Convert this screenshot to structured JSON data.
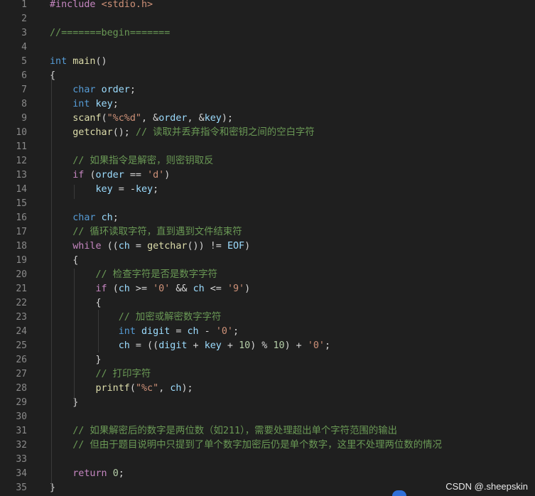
{
  "editor": {
    "theme": {
      "background": "#1f1f1f",
      "line_number": "#8a8a8a",
      "comment": "#6a9955"
    },
    "lines": [
      {
        "n": "1",
        "tokens": [
          [
            "pre",
            "#include "
          ],
          [
            "inc",
            "<stdio.h>"
          ]
        ]
      },
      {
        "n": "2",
        "tokens": []
      },
      {
        "n": "3",
        "tokens": [
          [
            "cm",
            "//=======begin======="
          ]
        ]
      },
      {
        "n": "4",
        "tokens": []
      },
      {
        "n": "5",
        "tokens": [
          [
            "kw",
            "int "
          ],
          [
            "fn",
            "main"
          ],
          [
            "op",
            "()"
          ]
        ]
      },
      {
        "n": "6",
        "tokens": [
          [
            "op",
            "{"
          ]
        ]
      },
      {
        "n": "7",
        "tokens": [
          [
            "op",
            "    "
          ],
          [
            "kw",
            "char "
          ],
          [
            "var",
            "order"
          ],
          [
            "op",
            ";"
          ]
        ]
      },
      {
        "n": "8",
        "tokens": [
          [
            "op",
            "    "
          ],
          [
            "kw",
            "int "
          ],
          [
            "var",
            "key"
          ],
          [
            "op",
            ";"
          ]
        ]
      },
      {
        "n": "9",
        "tokens": [
          [
            "op",
            "    "
          ],
          [
            "fn",
            "scanf"
          ],
          [
            "op",
            "("
          ],
          [
            "str",
            "\"%c%d\""
          ],
          [
            "op",
            ", &"
          ],
          [
            "var",
            "order"
          ],
          [
            "op",
            ", &"
          ],
          [
            "var",
            "key"
          ],
          [
            "op",
            ");"
          ]
        ]
      },
      {
        "n": "10",
        "tokens": [
          [
            "op",
            "    "
          ],
          [
            "fn",
            "getchar"
          ],
          [
            "op",
            "(); "
          ],
          [
            "cm",
            "// 读取并丢弃指令和密钥之间的空白字符"
          ]
        ]
      },
      {
        "n": "11",
        "tokens": []
      },
      {
        "n": "12",
        "tokens": [
          [
            "op",
            "    "
          ],
          [
            "cm",
            "// 如果指令是解密，则密钥取反"
          ]
        ]
      },
      {
        "n": "13",
        "tokens": [
          [
            "op",
            "    "
          ],
          [
            "ctrl",
            "if "
          ],
          [
            "op",
            "("
          ],
          [
            "var",
            "order"
          ],
          [
            "op",
            " == "
          ],
          [
            "str",
            "'d'"
          ],
          [
            "op",
            ")"
          ]
        ]
      },
      {
        "n": "14",
        "tokens": [
          [
            "op",
            "        "
          ],
          [
            "var",
            "key"
          ],
          [
            "op",
            " = -"
          ],
          [
            "var",
            "key"
          ],
          [
            "op",
            ";"
          ]
        ]
      },
      {
        "n": "15",
        "tokens": []
      },
      {
        "n": "16",
        "tokens": [
          [
            "op",
            "    "
          ],
          [
            "kw",
            "char "
          ],
          [
            "var",
            "ch"
          ],
          [
            "op",
            ";"
          ]
        ]
      },
      {
        "n": "17",
        "tokens": [
          [
            "op",
            "    "
          ],
          [
            "cm",
            "// 循环读取字符，直到遇到文件结束符"
          ]
        ]
      },
      {
        "n": "18",
        "tokens": [
          [
            "op",
            "    "
          ],
          [
            "ctrl",
            "while "
          ],
          [
            "op",
            "(("
          ],
          [
            "var",
            "ch"
          ],
          [
            "op",
            " = "
          ],
          [
            "fn",
            "getchar"
          ],
          [
            "op",
            "()) != "
          ],
          [
            "var",
            "EOF"
          ],
          [
            "op",
            ")"
          ]
        ]
      },
      {
        "n": "19",
        "tokens": [
          [
            "op",
            "    {"
          ]
        ]
      },
      {
        "n": "20",
        "tokens": [
          [
            "op",
            "        "
          ],
          [
            "cm",
            "// 检查字符是否是数字字符"
          ]
        ]
      },
      {
        "n": "21",
        "tokens": [
          [
            "op",
            "        "
          ],
          [
            "ctrl",
            "if "
          ],
          [
            "op",
            "("
          ],
          [
            "var",
            "ch"
          ],
          [
            "op",
            " >= "
          ],
          [
            "str",
            "'0'"
          ],
          [
            "op",
            " && "
          ],
          [
            "var",
            "ch"
          ],
          [
            "op",
            " <= "
          ],
          [
            "str",
            "'9'"
          ],
          [
            "op",
            ")"
          ]
        ]
      },
      {
        "n": "22",
        "tokens": [
          [
            "op",
            "        {"
          ]
        ]
      },
      {
        "n": "23",
        "tokens": [
          [
            "op",
            "            "
          ],
          [
            "cm",
            "// 加密或解密数字字符"
          ]
        ]
      },
      {
        "n": "24",
        "tokens": [
          [
            "op",
            "            "
          ],
          [
            "kw",
            "int "
          ],
          [
            "var",
            "digit"
          ],
          [
            "op",
            " = "
          ],
          [
            "var",
            "ch"
          ],
          [
            "op",
            " - "
          ],
          [
            "str",
            "'0'"
          ],
          [
            "op",
            ";"
          ]
        ]
      },
      {
        "n": "25",
        "tokens": [
          [
            "op",
            "            "
          ],
          [
            "var",
            "ch"
          ],
          [
            "op",
            " = (("
          ],
          [
            "var",
            "digit"
          ],
          [
            "op",
            " + "
          ],
          [
            "var",
            "key"
          ],
          [
            "op",
            " + "
          ],
          [
            "num",
            "10"
          ],
          [
            "op",
            ") % "
          ],
          [
            "num",
            "10"
          ],
          [
            "op",
            ") + "
          ],
          [
            "str",
            "'0'"
          ],
          [
            "op",
            ";"
          ]
        ]
      },
      {
        "n": "26",
        "tokens": [
          [
            "op",
            "        }"
          ]
        ]
      },
      {
        "n": "27",
        "tokens": [
          [
            "op",
            "        "
          ],
          [
            "cm",
            "// 打印字符"
          ]
        ]
      },
      {
        "n": "28",
        "tokens": [
          [
            "op",
            "        "
          ],
          [
            "fn",
            "printf"
          ],
          [
            "op",
            "("
          ],
          [
            "str",
            "\"%c\""
          ],
          [
            "op",
            ", "
          ],
          [
            "var",
            "ch"
          ],
          [
            "op",
            ");"
          ]
        ]
      },
      {
        "n": "29",
        "tokens": [
          [
            "op",
            "    }"
          ]
        ]
      },
      {
        "n": "30",
        "tokens": []
      },
      {
        "n": "31",
        "tokens": [
          [
            "op",
            "    "
          ],
          [
            "cm",
            "// 如果解密后的数字是两位数（如211），需要处理超出单个字符范围的输出"
          ]
        ]
      },
      {
        "n": "32",
        "tokens": [
          [
            "op",
            "    "
          ],
          [
            "cm",
            "// 但由于题目说明中只提到了单个数字加密后仍是单个数字，这里不处理两位数的情况"
          ]
        ]
      },
      {
        "n": "33",
        "tokens": []
      },
      {
        "n": "34",
        "tokens": [
          [
            "op",
            "    "
          ],
          [
            "ctrl",
            "return "
          ],
          [
            "num",
            "0"
          ],
          [
            "op",
            ";"
          ]
        ]
      },
      {
        "n": "35",
        "tokens": [
          [
            "op",
            "}"
          ]
        ]
      }
    ]
  },
  "watermark": {
    "text": "CSDN @.sheepskin"
  }
}
